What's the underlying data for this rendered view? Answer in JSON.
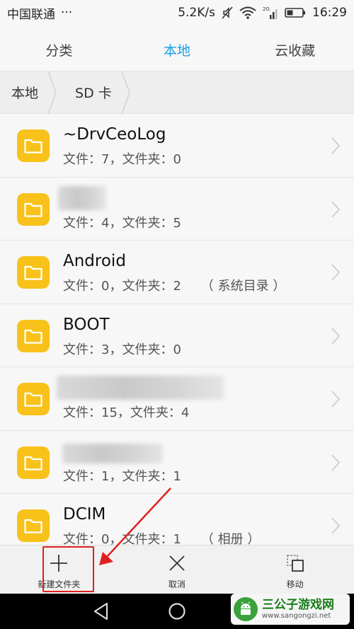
{
  "status_bar": {
    "carrier": "中国联通",
    "more": "···",
    "speed": "5.2K/s",
    "network_badge": "2G",
    "time": "16:29",
    "icons": [
      "mute-icon",
      "wifi-icon",
      "signal-icon",
      "battery-icon"
    ]
  },
  "tabs": [
    {
      "label": "分类",
      "active": false
    },
    {
      "label": "本地",
      "active": true
    },
    {
      "label": "云收藏",
      "active": false
    }
  ],
  "breadcrumb": [
    "本地",
    "SD 卡"
  ],
  "folders": [
    {
      "name": "~DrvCeoLog",
      "meta": "文件：7，文件夹：0",
      "tag": "",
      "redacted": false
    },
    {
      "name": "",
      "meta": "文件：4，文件夹：5",
      "tag": "",
      "redacted": true
    },
    {
      "name": "Android",
      "meta": "文件：0，文件夹：2",
      "tag": "（ 系统目录 ）",
      "redacted": false
    },
    {
      "name": "BOOT",
      "meta": "文件：3，文件夹：0",
      "tag": "",
      "redacted": false
    },
    {
      "name": "",
      "meta": "文件：15，文件夹：4",
      "tag": "",
      "redacted": true
    },
    {
      "name": "",
      "meta": "文件：1，文件夹：1",
      "tag": "",
      "redacted": true
    },
    {
      "name": "DCIM",
      "meta": "文件：0，文件夹：1",
      "tag": "（ 相册 ）",
      "redacted": false
    }
  ],
  "toolbar": {
    "new_folder_label": "新建文件夹",
    "cancel_label": "取消",
    "move_label": "移动"
  },
  "watermark": {
    "title": "三公子游戏网",
    "url": "www.sangongzi.net"
  },
  "colors": {
    "accent": "#19a0e1",
    "folder": "#f8c21a",
    "highlight": "#e02020"
  }
}
